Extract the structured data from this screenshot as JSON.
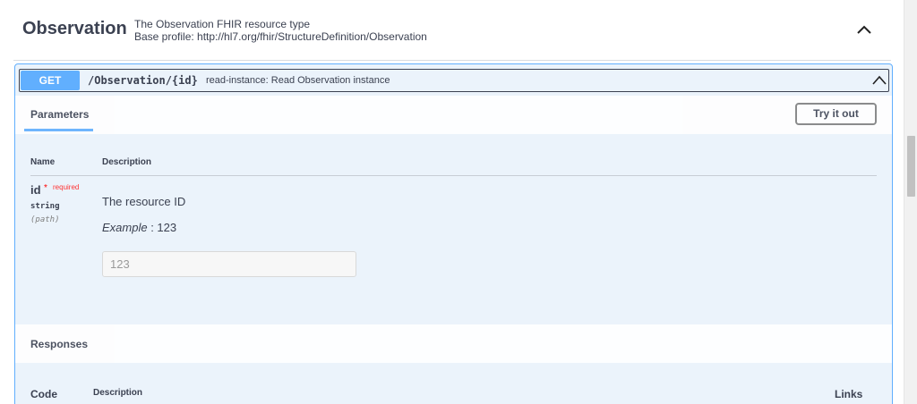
{
  "tag": {
    "name": "Observation",
    "description": "The Observation FHIR resource type",
    "profile": "Base profile: http://hl7.org/fhir/StructureDefinition/Observation",
    "toggle_icon": "chevron-up-icon"
  },
  "operation": {
    "method": "GET",
    "path": "/Observation/{id}",
    "summary": "read-instance: Read Observation instance",
    "toggle_icon": "chevron-up-icon",
    "color": "#61affe"
  },
  "parameters": {
    "tab_label": "Parameters",
    "try_button": "Try it out",
    "columns": {
      "name": "Name",
      "description": "Description"
    },
    "items": [
      {
        "name": "id",
        "required_star": "*",
        "required_label": "required",
        "type": "string",
        "in": "(path)",
        "description": "The resource ID",
        "example_label": "Example",
        "example_value": " : 123",
        "input_placeholder": "123"
      }
    ]
  },
  "responses": {
    "title": "Responses",
    "columns": {
      "code": "Code",
      "description": "Description",
      "links": "Links"
    }
  }
}
